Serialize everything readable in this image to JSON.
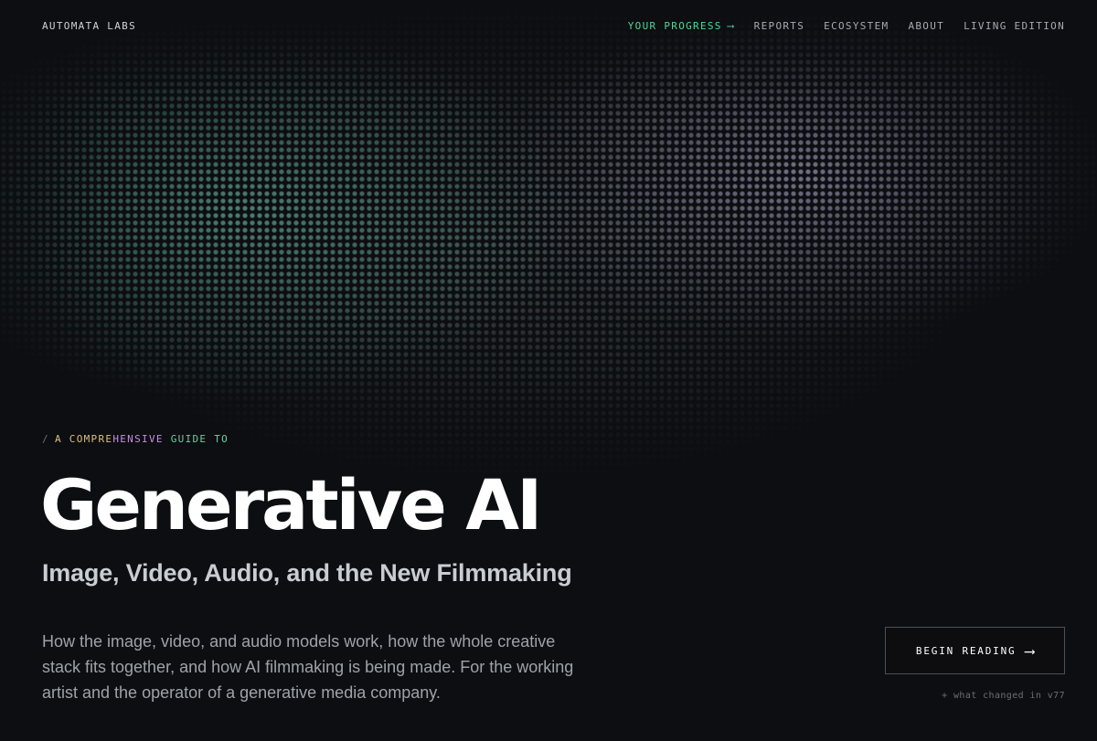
{
  "brand": {
    "name": "AUTOMATA LABS"
  },
  "nav": {
    "progress_label": "YOUR PROGRESS",
    "progress_arrow": "⟶",
    "items": [
      "REPORTS",
      "ECOSYSTEM",
      "ABOUT",
      "LIVING EDITION"
    ]
  },
  "hero": {
    "eyebrow_slash": "/",
    "eyebrow_lead": "A COMPRE",
    "eyebrow_mid": "HENSIVE",
    "eyebrow_tail": " GUIDE TO",
    "title": "Generative AI",
    "subtitle": "Image, Video, Audio, and the New Filmmaking",
    "description": "How the image, video, and audio models work, how the whole creative stack fits together, and how AI filmmaking is being made. For the working artist and the operator of a generative media company.",
    "cta_label": "BEGIN READING",
    "cta_arrow": "⟶",
    "changelog_link": "+ what changed in v77"
  },
  "colors": {
    "background": "#0d0e11",
    "accent_green": "#4fd69c",
    "eyebrow_gold": "#dcbf84",
    "eyebrow_violet": "#c58ee0",
    "eyebrow_teal": "#5fd3a8",
    "glow_teal": "#6ec8af",
    "glow_lavender": "#b9afd7"
  }
}
